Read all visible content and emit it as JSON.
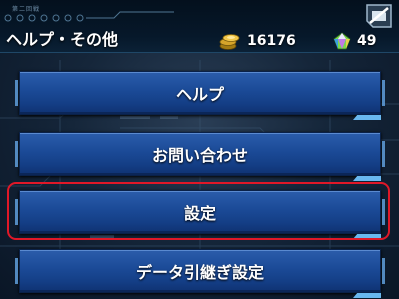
{
  "header": {
    "title": "ヘルプ・その他",
    "deco_label": "第二回戦",
    "currency": [
      {
        "icon": "gold-coins-icon",
        "value": "16176"
      },
      {
        "icon": "gem-icon",
        "value": "49"
      }
    ]
  },
  "menu": {
    "items": [
      {
        "label": "ヘルプ"
      },
      {
        "label": "お問い合わせ"
      },
      {
        "label": "設定",
        "selected": true
      },
      {
        "label": "データ引継ぎ設定"
      }
    ]
  },
  "colors": {
    "button_blue": "#1c4c99",
    "highlight_red": "#e01828",
    "accent_cyan": "#69b8ef"
  }
}
